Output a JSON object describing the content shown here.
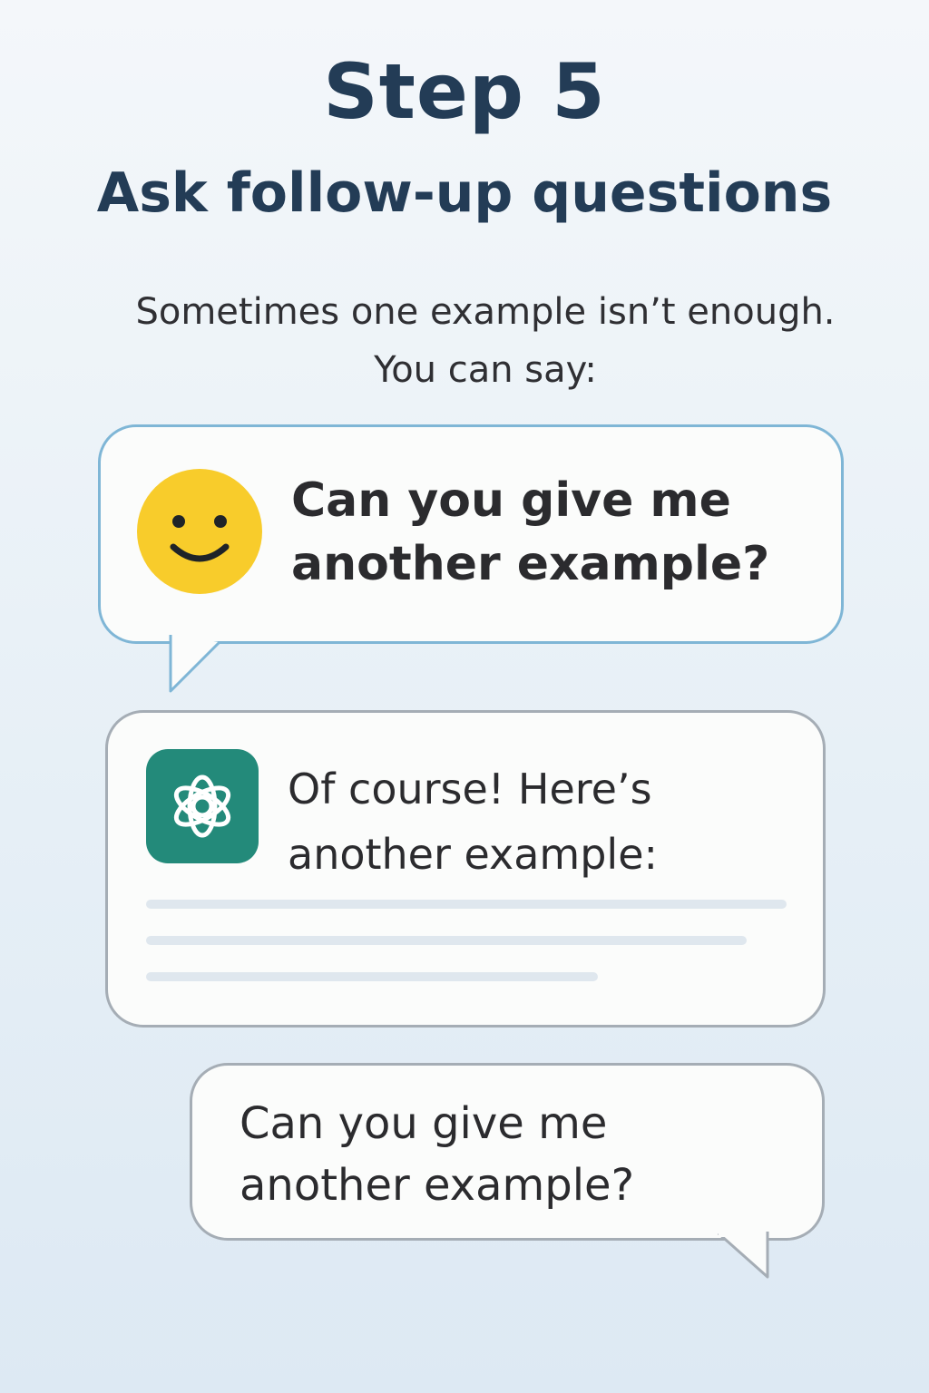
{
  "header": {
    "step": "Step 5",
    "subtitle": "Ask follow-up questions"
  },
  "intro": {
    "line1": "Sometimes one example isn’t enough.",
    "line2": "You can say:"
  },
  "user_message": {
    "avatar": "smiley-face-icon",
    "line1": "Can you give me",
    "line2": "another example?"
  },
  "assistant_message": {
    "avatar": "openai-logo-icon",
    "line1": "Of course! Here’s",
    "line2": "another example:"
  },
  "reply_message": {
    "line1": "Can you give me",
    "line2": "another example?"
  },
  "colors": {
    "title": "#233c56",
    "user_bubble_border": "#7fb6d6",
    "assistant_logo_bg": "#238a7a",
    "smiley": "#f8cc2b"
  }
}
